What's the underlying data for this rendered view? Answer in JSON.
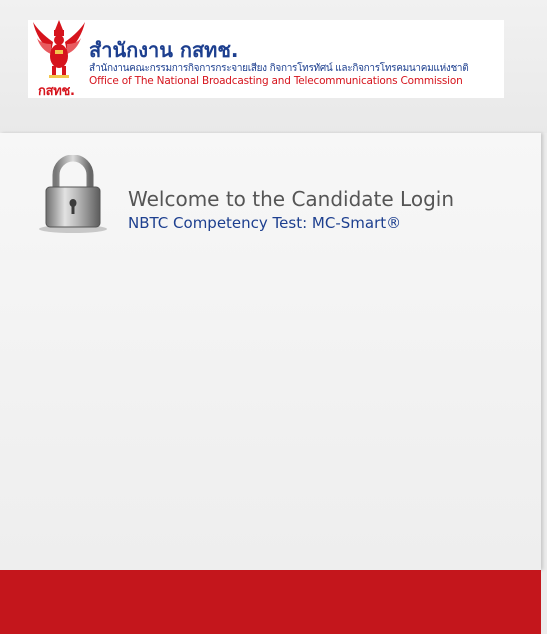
{
  "header": {
    "logo_acronym": "กสทช.",
    "org_title_thai": "สำนักงาน กสทช.",
    "org_subtitle_thai": "สำนักงานคณะกรรมการกิจการกระจายเสียง กิจการโทรทัศน์ และกิจการโทรคมนาคมแห่งชาติ",
    "org_subtitle_english": "Office of The National Broadcasting and Telecommunications Commission"
  },
  "login": {
    "icon": "padlock-icon",
    "welcome": "Welcome to the Candidate Login",
    "subtitle": "NBTC Competency Test: MC-Smart®"
  },
  "colors": {
    "brand_red": "#c4161c",
    "brand_blue": "#1d3f8f",
    "panel_bg": "#f3f3f3"
  }
}
